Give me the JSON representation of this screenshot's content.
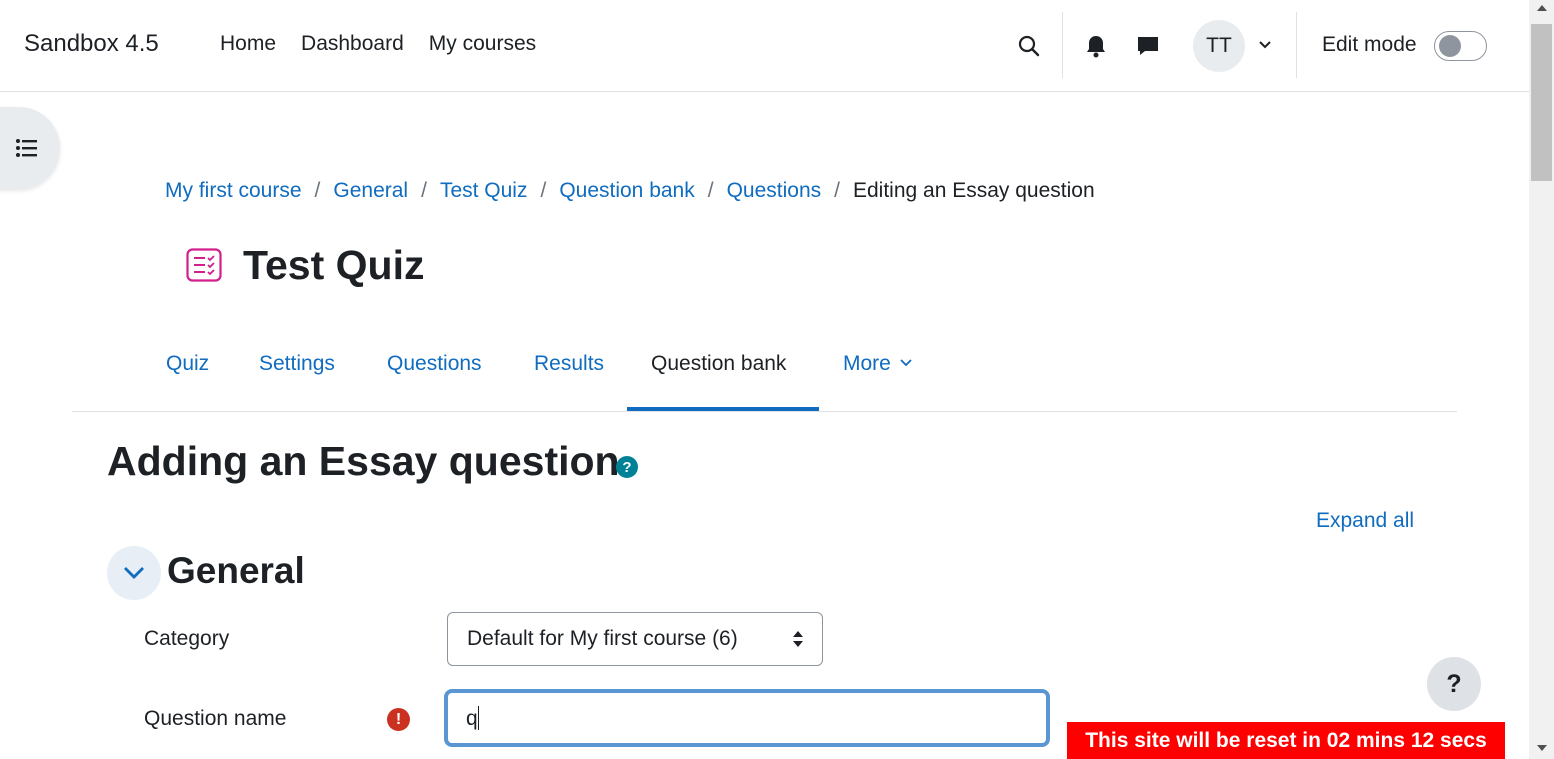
{
  "navbar": {
    "brand": "Sandbox 4.5",
    "links": [
      "Home",
      "Dashboard",
      "My courses"
    ],
    "user_initials": "TT",
    "edit_mode_label": "Edit mode"
  },
  "breadcrumb": {
    "items": [
      "My first course",
      "General",
      "Test Quiz",
      "Question bank",
      "Questions"
    ],
    "separator": "/",
    "current": "Editing an Essay question"
  },
  "page": {
    "title": "Test Quiz"
  },
  "secondary_nav": {
    "tabs": [
      "Quiz",
      "Settings",
      "Questions",
      "Results",
      "Question bank",
      "More"
    ],
    "active_tab": "Question bank"
  },
  "form": {
    "heading": "Adding an Essay question",
    "help_icon": "?",
    "expand_all": "Expand all",
    "section_general": "General",
    "category_label": "Category",
    "category_value": "Default for My first course (6)",
    "question_name_label": "Question name",
    "question_name_value": "q",
    "required_icon": "!"
  },
  "help_button": "?",
  "reset_banner": "This site will be reset in 02 mins 12 secs",
  "colors": {
    "link": "#0f6cbf",
    "text": "#1d2125",
    "help_teal": "#008196",
    "required_red": "#ca3120",
    "banner_red": "#ff0000",
    "quiz_icon_pink": "#d21f8c"
  },
  "icons": [
    "search-icon",
    "bell-icon",
    "chat-icon",
    "chevron-down-icon",
    "list-icon",
    "quiz-icon",
    "help-icon",
    "exclamation-icon"
  ]
}
